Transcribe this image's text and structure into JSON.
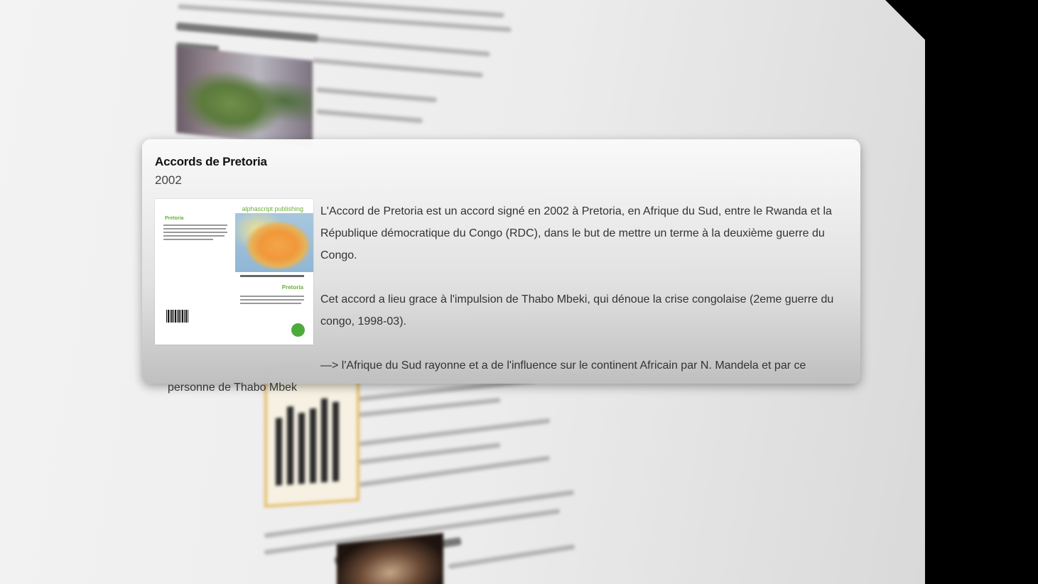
{
  "popover": {
    "title": "Accords de Pretoria",
    "year": "2002",
    "book_cover": {
      "publisher": "alphascript publishing",
      "title": "Pretoria"
    },
    "paragraphs": [
      "L'Accord de Pretoria est un accord signé en 2002 à Pretoria, en Afrique du Sud, entre le Rwanda et la République démocratique du Congo (RDC), dans le but de mettre un terme à la deuxième guerre du Congo.",
      "Cet accord a lieu grace à l'impulsion de Thabo Mbeki, qui dénoue la crise congolaise (2eme guerre du congo, 1998-03).",
      "—> l'Afrique du Sud rayonne et a de l'influence sur le continent Africain par N. Mandela et par ce personne de Thabo Mbek"
    ]
  }
}
